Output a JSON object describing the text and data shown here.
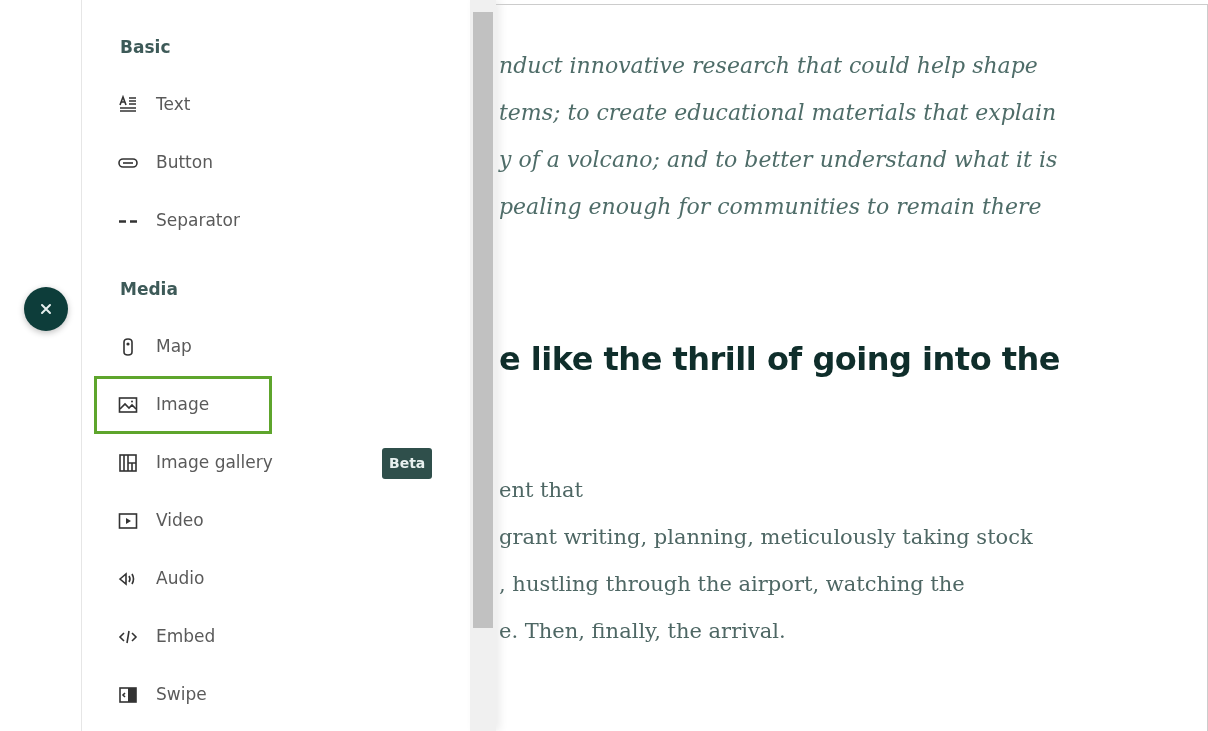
{
  "panel": {
    "sections": [
      {
        "heading": "Basic",
        "items": [
          {
            "label": "Text",
            "kind": "text",
            "highlighted": false
          },
          {
            "label": "Button",
            "kind": "button",
            "highlighted": false
          },
          {
            "label": "Separator",
            "kind": "separator",
            "highlighted": false
          }
        ]
      },
      {
        "heading": "Media",
        "items": [
          {
            "label": "Map",
            "kind": "map",
            "highlighted": false
          },
          {
            "label": "Image",
            "kind": "image",
            "highlighted": true
          },
          {
            "label": "Image gallery",
            "kind": "gallery",
            "highlighted": false,
            "badge": "Beta"
          },
          {
            "label": "Video",
            "kind": "video",
            "highlighted": false
          },
          {
            "label": "Audio",
            "kind": "audio",
            "highlighted": false
          },
          {
            "label": "Embed",
            "kind": "embed",
            "highlighted": false
          },
          {
            "label": "Swipe",
            "kind": "swipe",
            "highlighted": false
          }
        ]
      }
    ]
  },
  "story": {
    "quote_lines": [
      "nduct innovative research that could help shape",
      "tems; to create educational materials that explain",
      "y of a volcano; and to better understand what it is",
      "pealing enough for communities to remain there"
    ],
    "heading": "e like the thrill of going into the",
    "body_lines": [
      "ent that",
      "grant writing, planning, meticulously taking stock",
      ", hustling through the airport, watching the",
      "e. Then, finally, the arrival."
    ]
  }
}
